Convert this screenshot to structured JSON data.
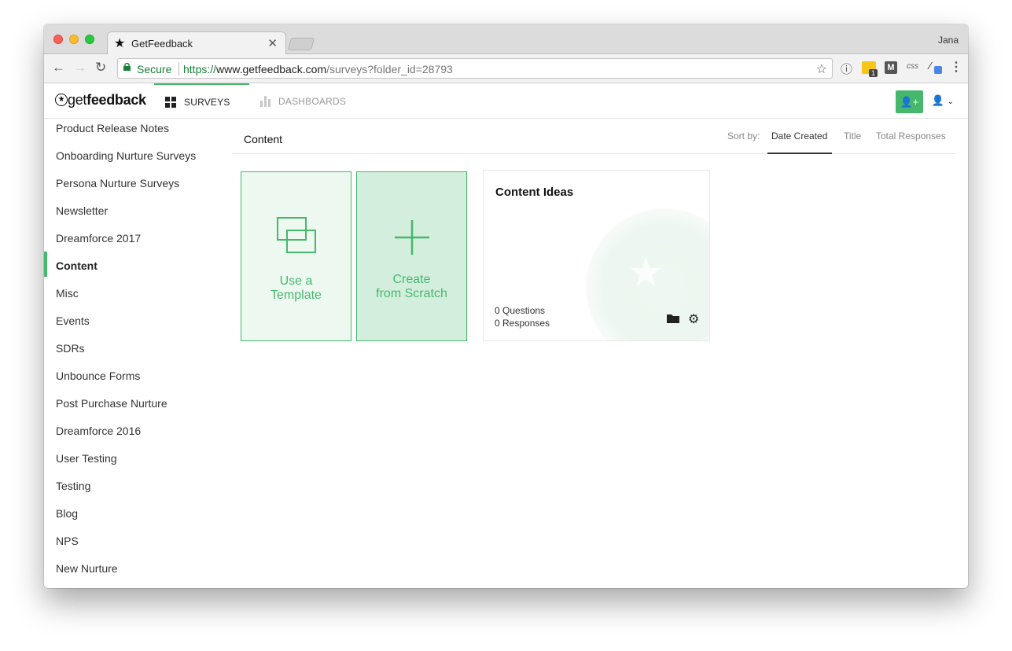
{
  "browser": {
    "tab_title": "GetFeedback",
    "profile_name": "Jana",
    "security_label": "Secure",
    "url_scheme": "https://",
    "url_host": "www.getfeedback.com",
    "url_path": "/surveys?folder_id=28793",
    "extension_badge": "1",
    "css_ext_label": "css"
  },
  "app": {
    "logo_light": "get",
    "logo_bold": "feedback",
    "nav": [
      {
        "label": "SURVEYS",
        "active": true
      },
      {
        "label": "DASHBOARDS",
        "active": false
      }
    ],
    "accent_color": "#45b86c"
  },
  "sidebar": {
    "items": [
      {
        "label": "Product Release Notes"
      },
      {
        "label": "Onboarding Nurture Surveys"
      },
      {
        "label": "Persona Nurture Surveys"
      },
      {
        "label": "Newsletter"
      },
      {
        "label": "Dreamforce 2017"
      },
      {
        "label": "Content",
        "active": true
      },
      {
        "label": "Misc"
      },
      {
        "label": "Events"
      },
      {
        "label": "SDRs"
      },
      {
        "label": "Unbounce Forms"
      },
      {
        "label": "Post Purchase Nurture"
      },
      {
        "label": "Dreamforce 2016"
      },
      {
        "label": "User Testing"
      },
      {
        "label": "Testing"
      },
      {
        "label": "Blog"
      },
      {
        "label": "NPS"
      },
      {
        "label": "New Nurture"
      }
    ]
  },
  "main": {
    "folder_title": "Content",
    "sort_label": "Sort by:",
    "sort_options": [
      {
        "label": "Date Created",
        "active": true
      },
      {
        "label": "Title"
      },
      {
        "label": "Total Responses"
      }
    ],
    "template_card": {
      "line1": "Use a",
      "line2": "Template"
    },
    "scratch_card": {
      "line1": "Create",
      "line2": "from Scratch"
    },
    "surveys": [
      {
        "title": "Content Ideas",
        "questions": "0 Questions",
        "responses": "0 Responses"
      }
    ]
  }
}
